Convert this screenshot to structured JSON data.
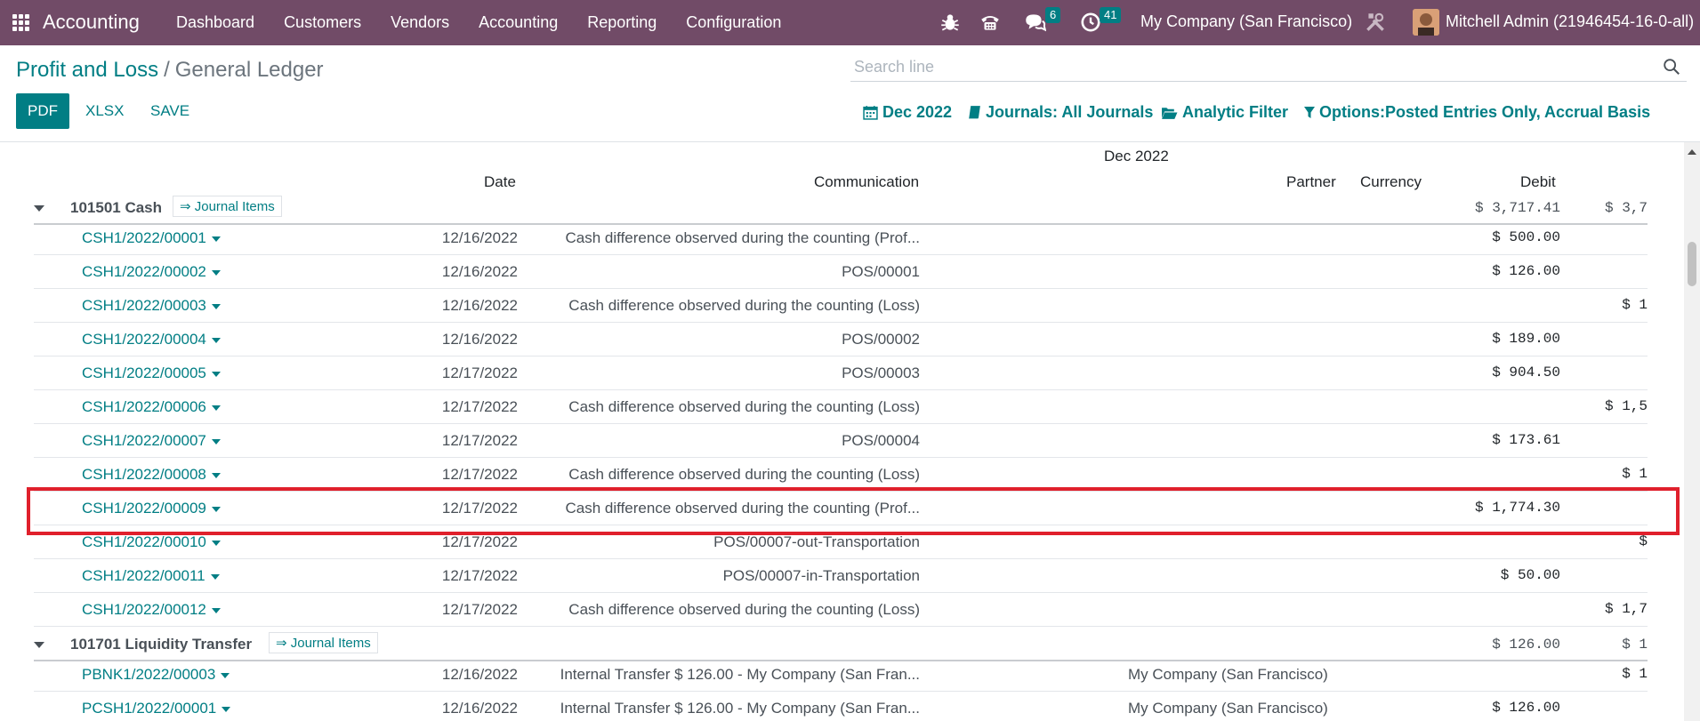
{
  "app": {
    "name": "Accounting",
    "menu": [
      "Dashboard",
      "Customers",
      "Vendors",
      "Accounting",
      "Reporting",
      "Configuration"
    ],
    "messages_badge": "6",
    "activities_badge": "41",
    "company": "My Company (San Francisco)",
    "user": "Mitchell Admin (21946454-16-0-all)",
    "nav_color": "#714B67",
    "accent_color": "#017e84"
  },
  "breadcrumb": {
    "parent": "Profit and Loss",
    "separator": "/",
    "current": "General Ledger"
  },
  "search": {
    "placeholder": "Search line",
    "value": ""
  },
  "buttons": {
    "pdf": "PDF",
    "xlsx": "XLSX",
    "save": "SAVE"
  },
  "filters": {
    "date": "Dec 2022",
    "journals": "Journals: All Journals",
    "analytic": "Analytic Filter",
    "options": "Options:Posted Entries Only, Accrual Basis"
  },
  "report": {
    "column_group": "Dec 2022",
    "columns": {
      "date": "Date",
      "communication": "Communication",
      "partner": "Partner",
      "currency": "Currency",
      "debit": "Debit"
    },
    "journal_items_label": "⇒ Journal Items",
    "accounts": [
      {
        "name": "101501 Cash",
        "debit": "$ 3,717.41",
        "credit": "$ 3,7",
        "lines": [
          {
            "move": "CSH1/2022/00001",
            "date": "12/16/2022",
            "communication": "Cash difference observed during the counting (Prof...",
            "partner": "",
            "debit": "$ 500.00",
            "credit": ""
          },
          {
            "move": "CSH1/2022/00002",
            "date": "12/16/2022",
            "communication": "POS/00001",
            "partner": "",
            "debit": "$ 126.00",
            "credit": ""
          },
          {
            "move": "CSH1/2022/00003",
            "date": "12/16/2022",
            "communication": "Cash difference observed during the counting (Loss)",
            "partner": "",
            "debit": "",
            "credit": "$ 1"
          },
          {
            "move": "CSH1/2022/00004",
            "date": "12/16/2022",
            "communication": "POS/00002",
            "partner": "",
            "debit": "$ 189.00",
            "credit": ""
          },
          {
            "move": "CSH1/2022/00005",
            "date": "12/17/2022",
            "communication": "POS/00003",
            "partner": "",
            "debit": "$ 904.50",
            "credit": ""
          },
          {
            "move": "CSH1/2022/00006",
            "date": "12/17/2022",
            "communication": "Cash difference observed during the counting (Loss)",
            "partner": "",
            "debit": "",
            "credit": "$ 1,5"
          },
          {
            "move": "CSH1/2022/00007",
            "date": "12/17/2022",
            "communication": "POS/00004",
            "partner": "",
            "debit": "$ 173.61",
            "credit": ""
          },
          {
            "move": "CSH1/2022/00008",
            "date": "12/17/2022",
            "communication": "Cash difference observed during the counting (Loss)",
            "partner": "",
            "debit": "",
            "credit": "$ 1"
          },
          {
            "move": "CSH1/2022/00009",
            "date": "12/17/2022",
            "communication": "Cash difference observed during the counting (Prof...",
            "partner": "",
            "debit": "$ 1,774.30",
            "credit": ""
          },
          {
            "move": "CSH1/2022/00010",
            "date": "12/17/2022",
            "communication": "POS/00007-out-Transportation",
            "partner": "",
            "debit": "",
            "credit": "$"
          },
          {
            "move": "CSH1/2022/00011",
            "date": "12/17/2022",
            "communication": "POS/00007-in-Transportation",
            "partner": "",
            "debit": "$ 50.00",
            "credit": ""
          },
          {
            "move": "CSH1/2022/00012",
            "date": "12/17/2022",
            "communication": "Cash difference observed during the counting (Loss)",
            "partner": "",
            "debit": "",
            "credit": "$ 1,7"
          }
        ]
      },
      {
        "name": "101701 Liquidity Transfer",
        "debit": "$ 126.00",
        "credit": "$ 1",
        "lines": [
          {
            "move": "PBNK1/2022/00003",
            "date": "12/16/2022",
            "communication": "Internal Transfer $ 126.00 - My Company (San Fran...",
            "partner": "My Company (San Francisco)",
            "debit": "",
            "credit": "$ 1"
          },
          {
            "move": "PCSH1/2022/00001",
            "date": "12/16/2022",
            "communication": "Internal Transfer $ 126.00 - My Company (San Fran...",
            "partner": "My Company (San Francisco)",
            "debit": "$ 126.00",
            "credit": ""
          }
        ]
      }
    ]
  }
}
